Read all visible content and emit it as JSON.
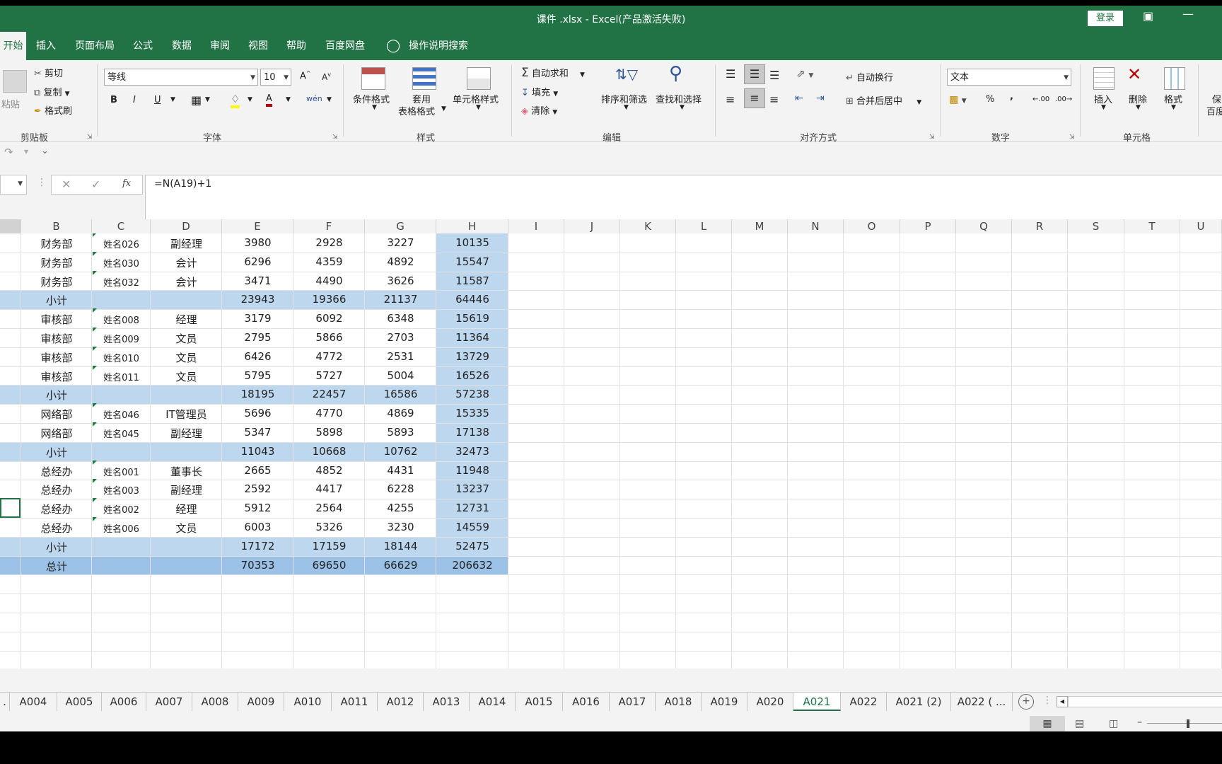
{
  "title": "课件 .xlsx  -  Excel(产品激活失败)",
  "login_label": "登录",
  "ribbon_tabs": [
    "开始",
    "插入",
    "页面布局",
    "公式",
    "数据",
    "审阅",
    "视图",
    "帮助",
    "百度网盘",
    "操作说明搜索"
  ],
  "clipboard": {
    "paste": "粘贴",
    "cut": "剪切",
    "copy": "复制",
    "format_painter": "格式刷",
    "group": "剪贴板"
  },
  "font": {
    "name": "等线",
    "size": "10",
    "group": "字体",
    "bold": "B",
    "italic": "I",
    "underline": "U",
    "font_color_letter": "A",
    "wen": "wén"
  },
  "styles": {
    "conditional": "条件格式",
    "table_1": "套用",
    "table_2": "表格格式",
    "cell_styles": "单元格样式",
    "group": "样式"
  },
  "editing": {
    "autosum": "自动求和",
    "fill": "填充",
    "clear": "清除",
    "sort": "排序和筛选",
    "find": "查找和选择",
    "group": "编辑"
  },
  "alignment": {
    "wrap": "自动换行",
    "merge": "合并后居中",
    "group": "对齐方式"
  },
  "number": {
    "format": "文本",
    "percent": "%",
    "comma": ",",
    "group": "数字"
  },
  "cells": {
    "insert": "插入",
    "delete": "删除",
    "format": "格式",
    "group": "单元格"
  },
  "protect_1": "保",
  "protect_2": "百度",
  "formula": "=N(A19)+1",
  "fx_label": "fx",
  "columns": [
    "B",
    "C",
    "D",
    "E",
    "F",
    "G",
    "H",
    "I",
    "J",
    "K",
    "L",
    "M",
    "N",
    "O",
    "P",
    "Q",
    "R",
    "S",
    "T",
    "U"
  ],
  "rows": [
    {
      "b": "财务部",
      "c": "姓名026",
      "d": "副经理",
      "e": "3980",
      "f": "2928",
      "g": "3227",
      "h": "10135"
    },
    {
      "b": "财务部",
      "c": "姓名030",
      "d": "会计",
      "e": "6296",
      "f": "4359",
      "g": "4892",
      "h": "15547"
    },
    {
      "b": "财务部",
      "c": "姓名032",
      "d": "会计",
      "e": "3471",
      "f": "4490",
      "g": "3626",
      "h": "11587"
    },
    {
      "b": "小计",
      "c": "",
      "d": "",
      "e": "23943",
      "f": "19366",
      "g": "21137",
      "h": "64446"
    },
    {
      "b": "审核部",
      "c": "姓名008",
      "d": "经理",
      "e": "3179",
      "f": "6092",
      "g": "6348",
      "h": "15619"
    },
    {
      "b": "审核部",
      "c": "姓名009",
      "d": "文员",
      "e": "2795",
      "f": "5866",
      "g": "2703",
      "h": "11364"
    },
    {
      "b": "审核部",
      "c": "姓名010",
      "d": "文员",
      "e": "6426",
      "f": "4772",
      "g": "2531",
      "h": "13729"
    },
    {
      "b": "审核部",
      "c": "姓名011",
      "d": "文员",
      "e": "5795",
      "f": "5727",
      "g": "5004",
      "h": "16526"
    },
    {
      "b": "小计",
      "c": "",
      "d": "",
      "e": "18195",
      "f": "22457",
      "g": "16586",
      "h": "57238"
    },
    {
      "b": "网络部",
      "c": "姓名046",
      "d": "IT管理员",
      "e": "5696",
      "f": "4770",
      "g": "4869",
      "h": "15335"
    },
    {
      "b": "网络部",
      "c": "姓名045",
      "d": "副经理",
      "e": "5347",
      "f": "5898",
      "g": "5893",
      "h": "17138"
    },
    {
      "b": "小计",
      "c": "",
      "d": "",
      "e": "11043",
      "f": "10668",
      "g": "10762",
      "h": "32473"
    },
    {
      "b": "总经办",
      "c": "姓名001",
      "d": "董事长",
      "e": "2665",
      "f": "4852",
      "g": "4431",
      "h": "11948"
    },
    {
      "b": "总经办",
      "c": "姓名003",
      "d": "副经理",
      "e": "2592",
      "f": "4417",
      "g": "6228",
      "h": "13237"
    },
    {
      "b": "总经办",
      "c": "姓名002",
      "d": "经理",
      "e": "5912",
      "f": "2564",
      "g": "4255",
      "h": "12731"
    },
    {
      "b": "总经办",
      "c": "姓名006",
      "d": "文员",
      "e": "6003",
      "f": "5326",
      "g": "3230",
      "h": "14559"
    },
    {
      "b": "小计",
      "c": "",
      "d": "",
      "e": "17172",
      "f": "17159",
      "g": "18144",
      "h": "52475"
    },
    {
      "b": "总计",
      "c": "",
      "d": "",
      "e": "70353",
      "f": "69650",
      "g": "66629",
      "h": "206632"
    }
  ],
  "sheets": [
    ".",
    "A004",
    "A005",
    "A006",
    "A007",
    "A008",
    "A009",
    "A010",
    "A011",
    "A012",
    "A013",
    "A014",
    "A015",
    "A016",
    "A017",
    "A018",
    "A019",
    "A020",
    "A021",
    "A022",
    "A021 (2)",
    "A022 ( ..."
  ],
  "active_sheet": "A021",
  "colors": {
    "brand": "#217346",
    "subtotal": "#bdd7ee",
    "total": "#9bc2e6",
    "hcol": "#bdd7ee"
  }
}
